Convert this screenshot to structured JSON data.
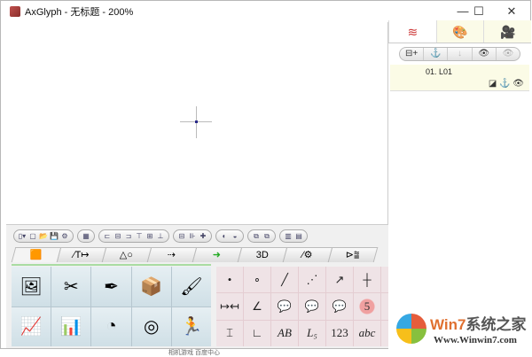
{
  "window": {
    "title": "AxGlyph - 无标题 - 200%",
    "minimize": "—",
    "maximize": "☐",
    "close": "✕"
  },
  "right_panel": {
    "tabs": [
      {
        "icon": "layers-icon",
        "glyph": "≋"
      },
      {
        "icon": "palette-icon",
        "glyph": "🎨"
      },
      {
        "icon": "camera-icon",
        "glyph": "🎥"
      }
    ],
    "buttons": [
      "⊟+",
      "⚓",
      "↓",
      "👁",
      "👁"
    ],
    "layer": {
      "name": "01. L01",
      "icons": "◪ ⚓ 👁"
    }
  },
  "toolbar": {
    "groups": [
      [
        "▯▾",
        "▢",
        "📂",
        "💾",
        "⚙"
      ],
      [
        "▦"
      ],
      [
        "⊏",
        "⊟",
        "⊐",
        "⊤",
        "⊞",
        "⊥"
      ],
      [
        "⊟",
        "⊪",
        "✚"
      ],
      [
        "◐",
        "◒"
      ],
      [
        "⧉",
        "⧉"
      ],
      [
        "▥",
        "▤"
      ]
    ]
  },
  "tabs": [
    "🟧",
    "∕T↦",
    "△○",
    "⇢",
    "➜",
    "3D",
    "⁄⚙",
    "⊳⩰"
  ],
  "left_tools": [
    "🖼",
    "✂",
    "✒",
    "📦",
    "🖌",
    "📈",
    "📊",
    "◔",
    "◎",
    "🏃"
  ],
  "right_tools": [
    "•",
    "∘",
    "╱",
    "⋰",
    "↗",
    "┼",
    "",
    "↦↤",
    "∠",
    "💬",
    "💬",
    "💬",
    "5",
    "",
    "⌶",
    "∟",
    "AB",
    "L₅",
    "123",
    "abc",
    ""
  ],
  "watermark": {
    "brand_w": "Win7",
    "brand_rest": "系统之家",
    "url": "Www.Winwin7.com"
  },
  "background_text": "相机游戏    百度中心"
}
